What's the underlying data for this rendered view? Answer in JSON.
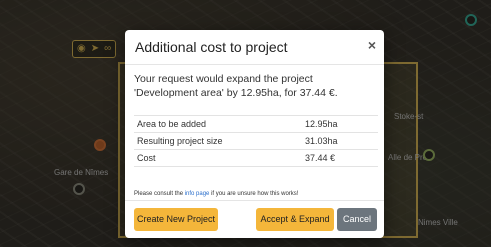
{
  "map": {
    "toolbar_icons": [
      "eye-icon",
      "share-icon",
      "link-icon"
    ],
    "labels": [
      "Stoke-st",
      "Alle de Pré",
      "Gare de Nîmes",
      "Nimes Ville"
    ]
  },
  "modal": {
    "title": "Additional cost to project",
    "close_glyph": "×",
    "intro": "Your request would expand the project 'Development area' by 12.95ha, for 37.44 €.",
    "rows": [
      {
        "label": "Area to be added",
        "value": "12.95ha"
      },
      {
        "label": "Resulting project size",
        "value": "31.03ha"
      },
      {
        "label": "Cost",
        "value": "37.44 €"
      }
    ],
    "help": {
      "prefix": "Please consult the ",
      "link": "info page",
      "suffix": " if you are unsure how this works!"
    },
    "buttons": {
      "create": "Create New Project",
      "accept": "Accept & Expand",
      "cancel": "Cancel"
    }
  },
  "colors": {
    "accent": "#f4b63a",
    "cancel": "#6c757d",
    "link": "#2a6ecb",
    "project_outline": "#e6c25a"
  }
}
